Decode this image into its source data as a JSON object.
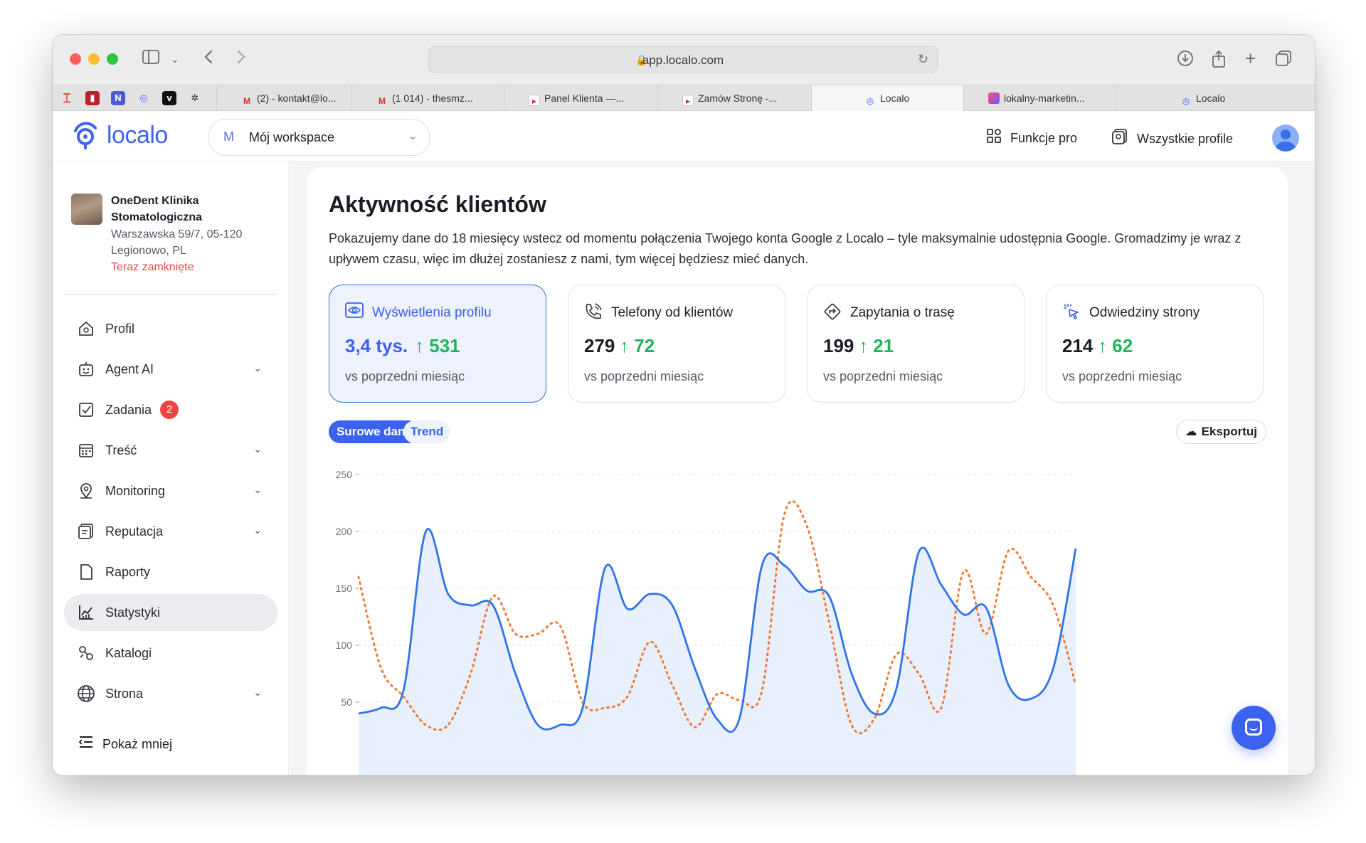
{
  "browser": {
    "url": "app.localo.com",
    "tabs": [
      {
        "label": "(2) - kontakt@lo..."
      },
      {
        "label": "(1 014) - thesmz..."
      },
      {
        "label": "Panel Klienta —..."
      },
      {
        "label": "Zamów Stronę -..."
      },
      {
        "label": "Localo"
      },
      {
        "label": "lokalny-marketin..."
      },
      {
        "label": "Localo"
      }
    ]
  },
  "header": {
    "logo": "localo",
    "workspace_initial": "M",
    "workspace": "Mój workspace",
    "pro_features": "Funkcje pro",
    "all_profiles": "Wszystkie profile"
  },
  "sidebar": {
    "business_name": "OneDent Klinika Stomatologiczna",
    "business_address": "Warszawska 59/7, 05-120 Legionowo, PL",
    "business_status": "Teraz zamknięte",
    "items": [
      {
        "label": "Profil",
        "icon": "profile-icon"
      },
      {
        "label": "Agent AI",
        "icon": "robot-icon"
      },
      {
        "label": "Zadania",
        "icon": "checkbox-icon",
        "badge": "2"
      },
      {
        "label": "Treść",
        "icon": "calendar-icon"
      },
      {
        "label": "Monitoring",
        "icon": "location-pin-icon"
      },
      {
        "label": "Reputacja",
        "icon": "reviews-icon"
      },
      {
        "label": "Raporty",
        "icon": "document-icon"
      },
      {
        "label": "Statystyki",
        "icon": "chart-icon"
      },
      {
        "label": "Katalogi",
        "icon": "link-icon"
      },
      {
        "label": "Strona",
        "icon": "globe-icon"
      }
    ],
    "show_less": "Pokaż mniej"
  },
  "main": {
    "title": "Aktywność klientów",
    "description": "Pokazujemy dane do 18 miesięcy wstecz od momentu połączenia Twojego konta Google z Localo – tyle maksymalnie udostępnia Google. Gromadzimy je wraz z upływem czasu, więc im dłużej zostaniesz z nami, tym więcej będziesz mieć danych.",
    "stats": [
      {
        "title": "Wyświetlenia profilu",
        "value": "3,4 tys.",
        "delta": "531",
        "sub": "vs poprzedni miesiąc"
      },
      {
        "title": "Telefony od klientów",
        "value": "279",
        "delta": "72",
        "sub": "vs poprzedni miesiąc"
      },
      {
        "title": "Zapytania o trasę",
        "value": "199",
        "delta": "21",
        "sub": "vs poprzedni miesiąc"
      },
      {
        "title": "Odwiedziny strony",
        "value": "214",
        "delta": "62",
        "sub": "vs poprzedni miesiąc"
      }
    ],
    "toggle_raw": "Surowe dane",
    "toggle_trend": "Trend",
    "export": "Eksportuj"
  },
  "colors": {
    "accent": "#3b62ee",
    "positive": "#22b35e",
    "series_current": "#2f74e6",
    "series_previous": "#f07a3a"
  },
  "chart_data": {
    "type": "line",
    "ylim": [
      40,
      250
    ],
    "yticks": [
      250,
      200,
      150,
      100,
      50
    ],
    "grid": true,
    "series": [
      {
        "style": "solid-area",
        "values": [
          40,
          45,
          60,
          200,
          145,
          135,
          135,
          75,
          30,
          30,
          45,
          168,
          132,
          145,
          135,
          80,
          35,
          36,
          170,
          170,
          148,
          143,
          75,
          40,
          62,
          182,
          153,
          127,
          133,
          65,
          53,
          80,
          185
        ]
      },
      {
        "style": "dotted",
        "values": [
          160,
          80,
          55,
          30,
          30,
          75,
          143,
          110,
          110,
          117,
          50,
          45,
          55,
          103,
          65,
          28,
          57,
          52,
          60,
          215,
          205,
          120,
          30,
          35,
          92,
          75,
          45,
          165,
          110,
          183,
          160,
          135,
          65
        ]
      }
    ]
  }
}
